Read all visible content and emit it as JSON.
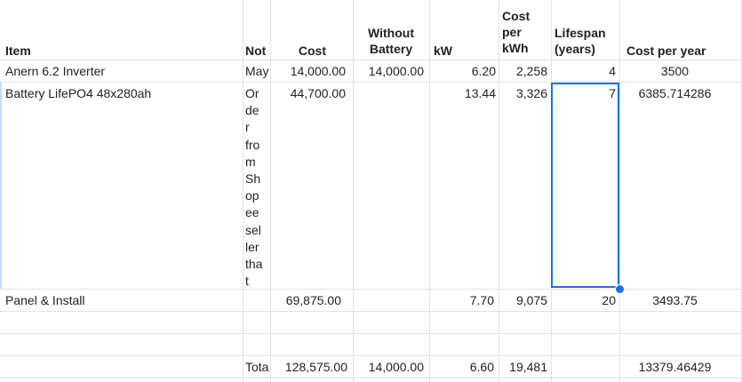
{
  "headers": {
    "item": "Item",
    "notes": "Not",
    "cost": "Cost",
    "without_battery": "Without\nBattery",
    "kw": "kW",
    "cost_per_kwh": "Cost\nper\nkWh",
    "lifespan": "Lifespan\n(years)",
    "cost_per_year": "Cost per year"
  },
  "rows": [
    {
      "item": "Anern 6.2 Inverter",
      "notes": "May",
      "cost": "14,000.00",
      "without_battery": "14,000.00",
      "kw": "6.20",
      "cost_per_kwh": "2,258",
      "lifespan": "4",
      "cost_per_year": "3500"
    },
    {
      "item": "Battery LifePO4 48x280ah",
      "notes": "Or\nde\nr\nfro\nm\nSh\nop\nee\nsel\nler\ntha\nt",
      "cost": "44,700.00",
      "without_battery": "",
      "kw": "13.44",
      "cost_per_kwh": "3,326",
      "lifespan": "7",
      "cost_per_year": "6385.714286"
    },
    {
      "item": "Panel & Install",
      "notes": "",
      "cost": "69,875.00",
      "without_battery": "",
      "kw": "7.70",
      "cost_per_kwh": "9,075",
      "lifespan": "20",
      "cost_per_year": "3493.75"
    }
  ],
  "totals": {
    "label": "Tota",
    "cost": "128,575.00",
    "without_battery": "14,000.00",
    "kw": "6.60",
    "cost_per_kwh": "19,481",
    "cost_per_year": "13379.46429"
  },
  "colors": {
    "gridline": "#e2e2e2",
    "selection": "#1a73e8"
  }
}
